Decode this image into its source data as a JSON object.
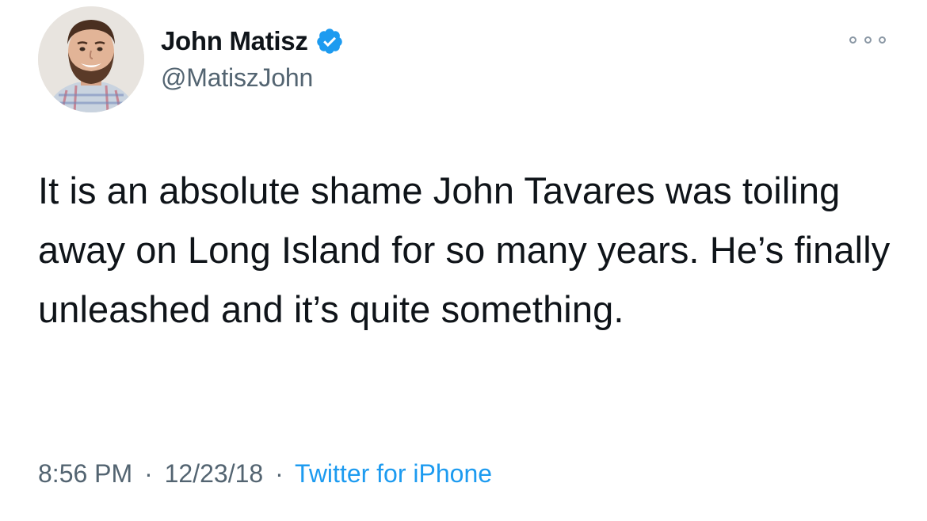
{
  "tweet": {
    "author": {
      "display_name": "John Matisz",
      "handle": "@MatiszJohn",
      "verified": true
    },
    "text": "It is an absolute shame John Tavares was toiling away on Long Island for so many years. He’s finally unleashed and it’s quite something.",
    "time": "8:56 PM",
    "date": "12/23/18",
    "source": "Twitter for iPhone",
    "separator": "·"
  },
  "colors": {
    "text": "#0f1419",
    "secondary": "#536471",
    "accent": "#1d9bf0"
  },
  "icons": {
    "verified": "verified-badge-icon",
    "more": "more-options-icon"
  }
}
